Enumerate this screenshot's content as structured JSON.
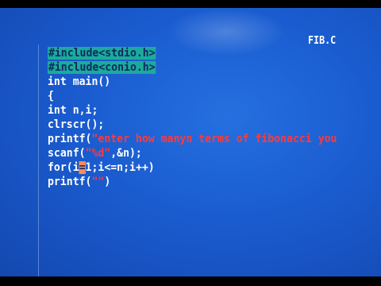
{
  "window": {
    "filename": "FIB.C"
  },
  "editor": {
    "lines": [
      {
        "kind": "directive",
        "text": "#include<stdio.h>"
      },
      {
        "kind": "directive",
        "text": "#include<conio.h>"
      },
      {
        "kind": "code",
        "text": "int main()"
      },
      {
        "kind": "code",
        "text": "{"
      },
      {
        "kind": "code",
        "text": "int n,i;"
      },
      {
        "kind": "code",
        "text": "clrscr();"
      },
      {
        "kind": "call",
        "prefix": "printf(",
        "string": "\"enter how manyn terms of fibonacci you"
      },
      {
        "kind": "call",
        "prefix": "scanf(",
        "string": "\"%d\"",
        "suffix": ",&n);"
      },
      {
        "kind": "cursor",
        "before": "for(i",
        "at": "=",
        "after": "1;i<=n;i++)"
      },
      {
        "kind": "call",
        "prefix": "printf(",
        "string": "\"\"",
        "suffix": ")"
      }
    ]
  },
  "colors": {
    "background": "#1a5cd0",
    "text": "#ffffff",
    "string": "#ff3a3a",
    "directive_highlight": "#1cab9a",
    "cursor": "#ff8a5a"
  }
}
